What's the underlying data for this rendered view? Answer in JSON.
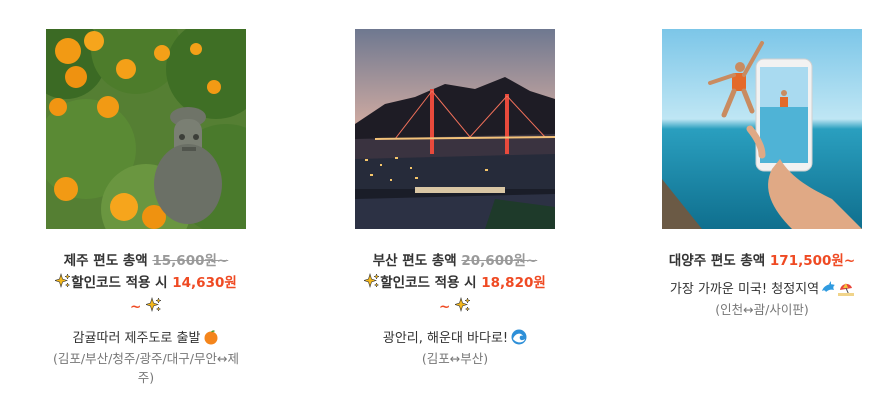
{
  "products": [
    {
      "title_prefix": "제주 편도 총액",
      "old_price": "15,600원~",
      "promo_label": "할인코드 적용 시",
      "promo_price": "14,630원",
      "promo_suffix": "~",
      "description": "감귤따러 제주도로 출발",
      "route": "(김포/부산/청주/광주/대구/무안↔제주)",
      "image": "jeju-tangerine-stone-statue-photo",
      "desc_icon": "tangerine-icon"
    },
    {
      "title_prefix": "부산 편도 총액",
      "old_price": "20,600원~",
      "promo_label": "할인코드 적용 시",
      "promo_price": "18,820원",
      "promo_suffix": "~",
      "description": "광안리, 해운대 바다로!",
      "route": "(김포↔부산)",
      "image": "busan-bridge-night-photo",
      "desc_icon": "wave-icon"
    },
    {
      "title_prefix": "대양주 편도 총액",
      "price": "171,500원~",
      "description": "가장 가까운 미국! 청정지역",
      "route": "(인천↔괌/사이판)",
      "image": "ocean-jump-phone-photo",
      "desc_icons": [
        "dolphin-icon",
        "beach-umbrella-icon"
      ]
    }
  ],
  "colors": {
    "price": "#ef4a23",
    "old_price": "#9a9a9a"
  }
}
